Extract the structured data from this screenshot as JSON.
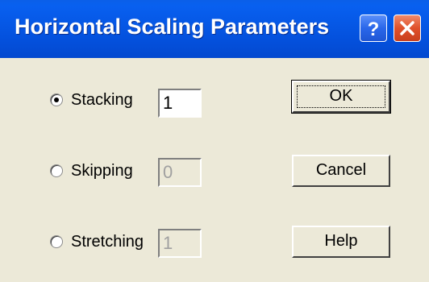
{
  "window": {
    "title": "Horizontal Scaling Parameters",
    "help_button": "?",
    "close_button": "X"
  },
  "options": [
    {
      "label": "Stacking",
      "selected": true,
      "value": "1",
      "enabled": true
    },
    {
      "label": "Skipping",
      "selected": false,
      "value": "0",
      "enabled": false
    },
    {
      "label": "Stretching",
      "selected": false,
      "value": "1",
      "enabled": false
    }
  ],
  "buttons": {
    "ok": "OK",
    "cancel": "Cancel",
    "help": "Help"
  },
  "colors": {
    "titlebar": "#0450dc",
    "dialog_face": "#ece9d8",
    "close_button": "#e0502a"
  }
}
